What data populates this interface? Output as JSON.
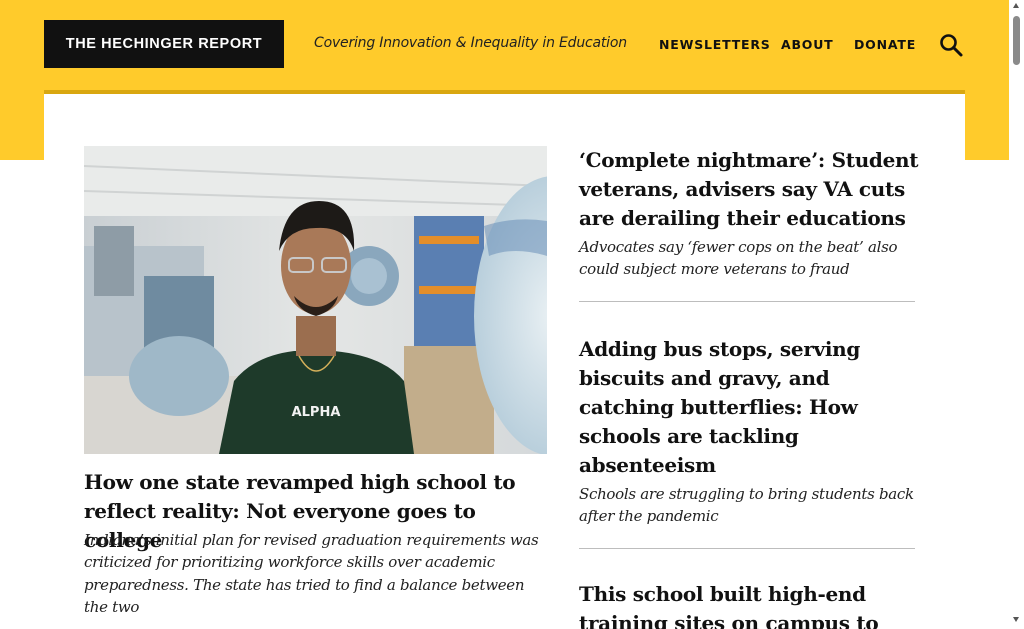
{
  "brand": {
    "logo_text": "THE HECHINGER REPORT",
    "tagline": "Covering Innovation & Inequality in Education",
    "accent_color": "#ffcb2b"
  },
  "nav": {
    "newsletters": "NEWSLETTERS",
    "about": "ABOUT",
    "donate": "DONATE",
    "search_icon": "search-icon"
  },
  "main_story": {
    "headline": "How one state revamped high school to reflect reality: Not everyone goes to college",
    "dek": "Indiana’s initial plan for revised graduation requirements was criticized for prioritizing workforce skills over academic preparedness. The state has tried to find a balance between the two",
    "shirt_text": "ALPHA"
  },
  "side_stories": [
    {
      "headline": "‘Complete nightmare’: Student veterans, advisers say VA cuts are derailing their educations",
      "dek": "Advocates say ‘fewer cops on the beat’ also could subject more veterans to fraud"
    },
    {
      "headline": "Adding bus stops, serving biscuits and gravy, and catching butterflies: How schools are tackling absenteeism",
      "dek": "Schools are struggling to bring students back after the pandemic"
    },
    {
      "headline": "This school built high-end training sites on campus to"
    }
  ]
}
